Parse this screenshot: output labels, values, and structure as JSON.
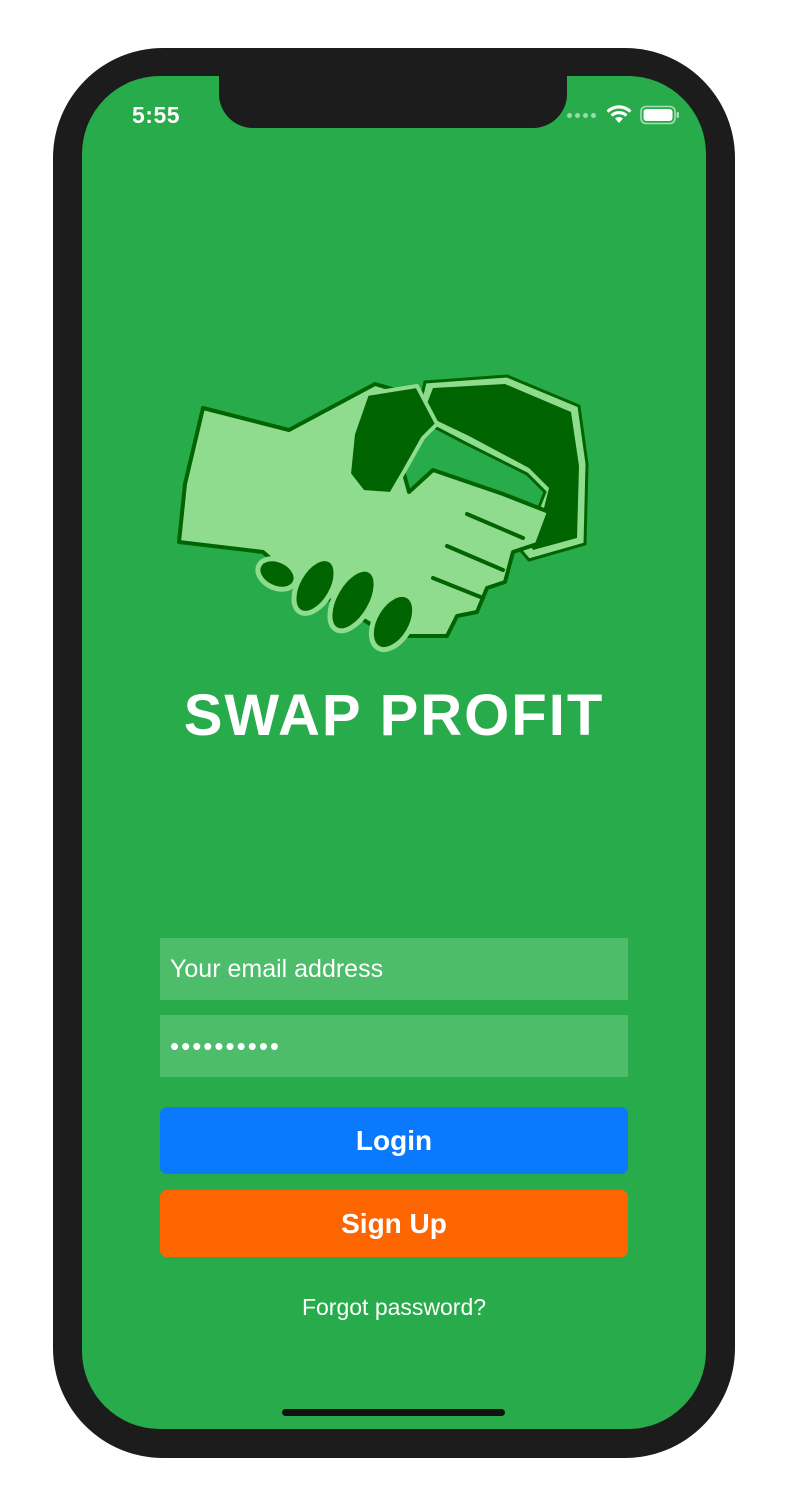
{
  "status_bar": {
    "time": "5:55",
    "wifi_icon": "wifi-icon",
    "battery_icon": "battery-icon"
  },
  "app": {
    "title": "SWAP PROFIT",
    "logo_icon": "handshake-icon"
  },
  "login_form": {
    "email_placeholder": "Your email address",
    "email_value": "",
    "password_value": "••••••••••",
    "login_label": "Login",
    "signup_label": "Sign Up",
    "forgot_label": "Forgot password?"
  },
  "colors": {
    "background": "#28ab4a",
    "field_background": "#4ebd6b",
    "login_button": "#0a79fb",
    "signup_button": "#fd6500",
    "logo_light": "#8fdc8f",
    "logo_dark": "#006400"
  }
}
